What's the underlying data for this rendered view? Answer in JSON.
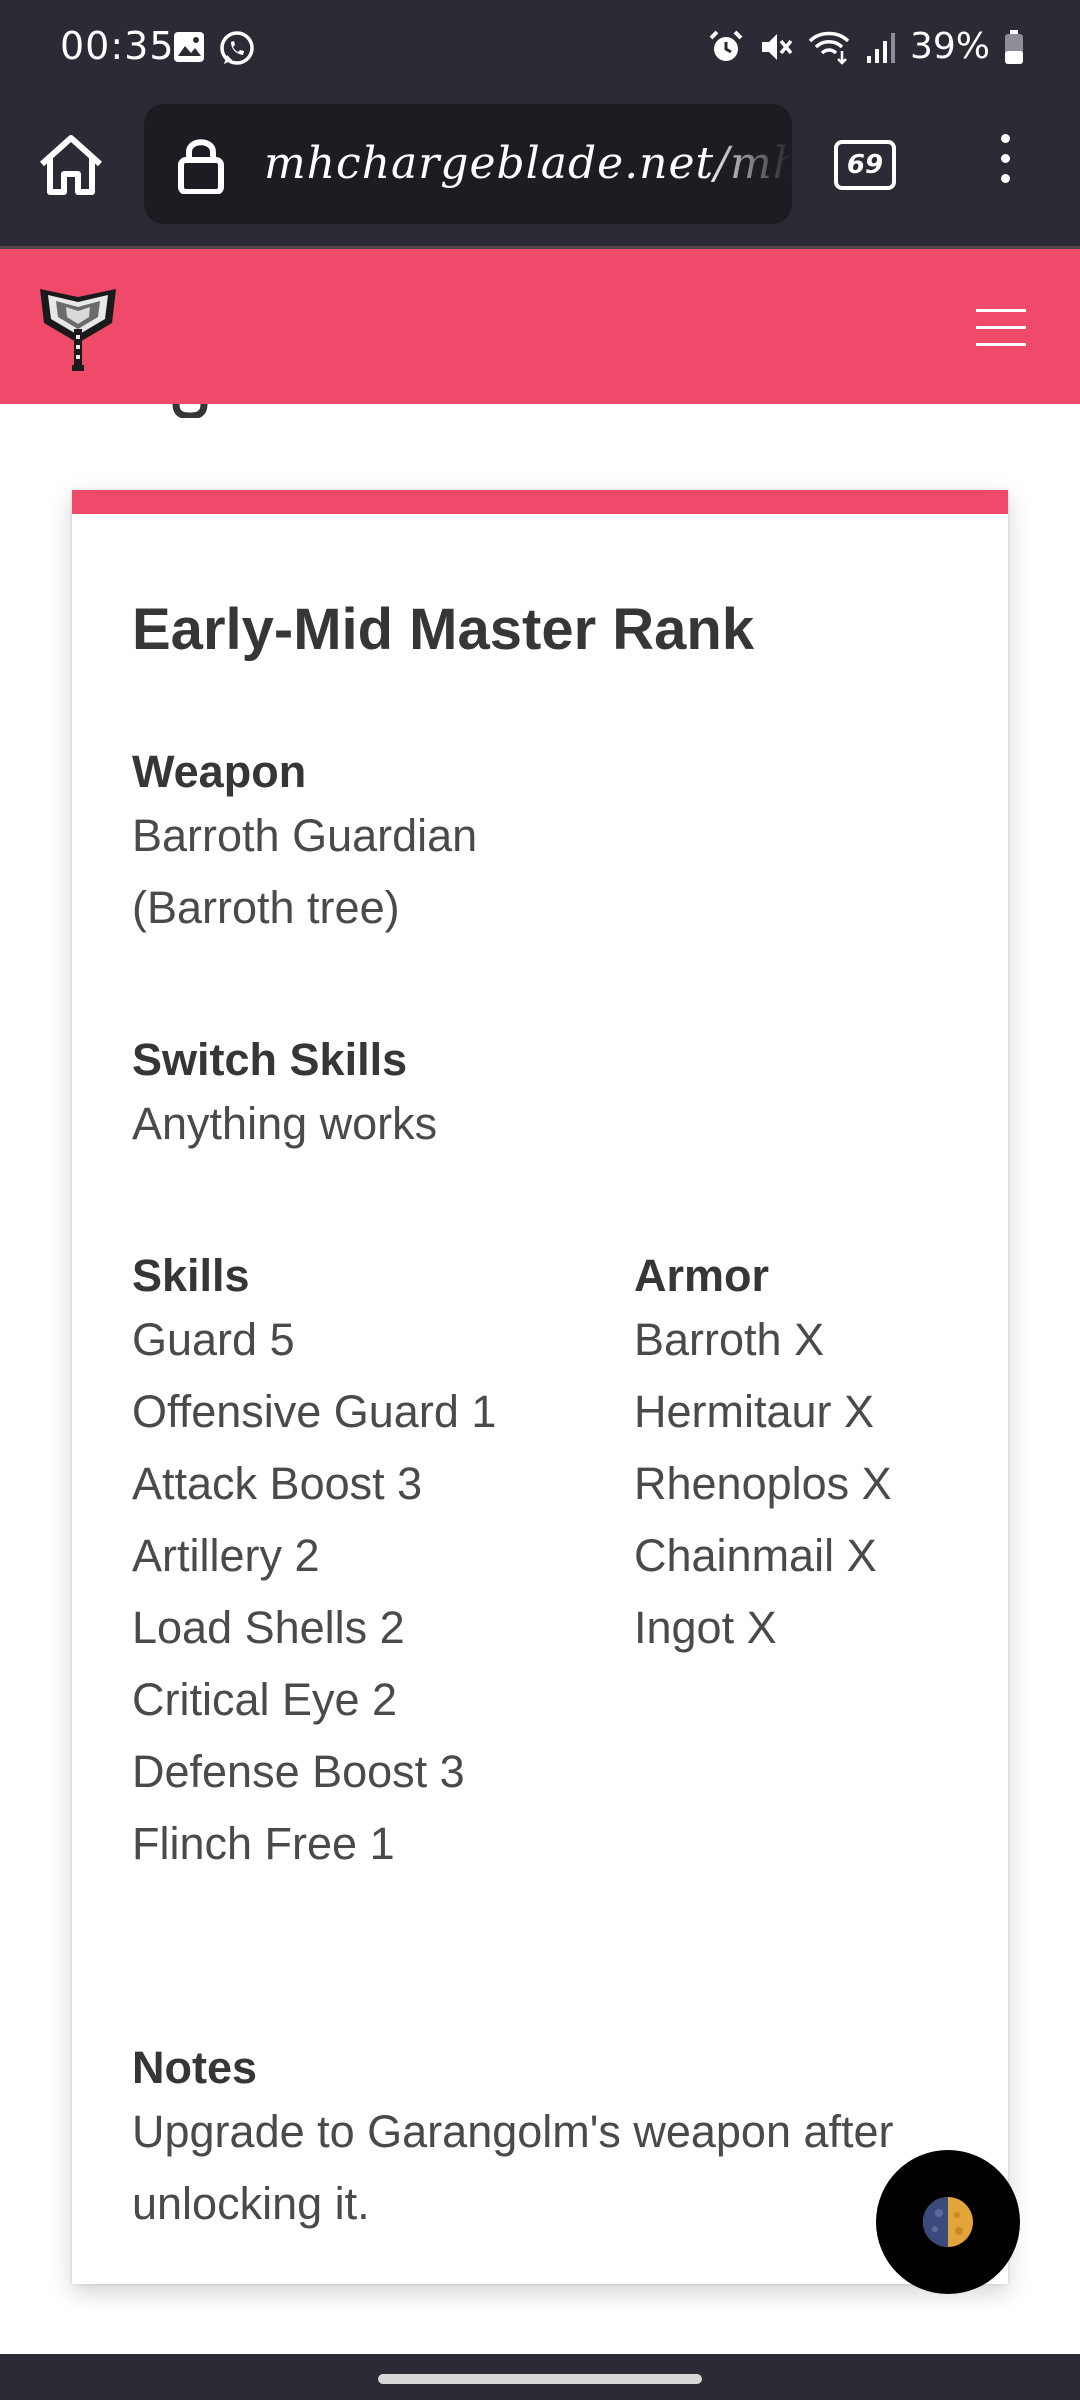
{
  "status_bar": {
    "time": "00:35",
    "battery": "39%",
    "icons": [
      "gallery-icon",
      "whatsapp-icon",
      "alarm-icon",
      "mute-icon",
      "wifi-icon",
      "signal-icon",
      "battery-icon"
    ]
  },
  "browser": {
    "url": "mhchargeblade.net/mhr/",
    "tab_count": "69"
  },
  "card": {
    "title": "Early-Mid Master Rank",
    "weapon": {
      "label": "Weapon",
      "lines": [
        "Barroth Guardian",
        "(Barroth tree)"
      ]
    },
    "switch_skills": {
      "label": "Switch Skills",
      "value": "Anything works"
    },
    "skills": {
      "label": "Skills",
      "items": [
        "Guard 5",
        "Offensive Guard 1",
        "Attack Boost 3",
        "Artillery 2",
        "Load Shells 2",
        "Critical Eye 2",
        "Defense Boost 3",
        "Flinch Free 1"
      ]
    },
    "armor": {
      "label": "Armor",
      "items": [
        "Barroth X",
        "Hermitaur X",
        "Rhenoplos X",
        "Chainmail X",
        "Ingot X"
      ]
    },
    "notes": {
      "label": "Notes",
      "lines": [
        "Upgrade to Garangolm's weapon after",
        "unlocking it."
      ]
    }
  },
  "colors": {
    "accent": "#ef4a6a",
    "system_bar": "#2a2b34"
  }
}
